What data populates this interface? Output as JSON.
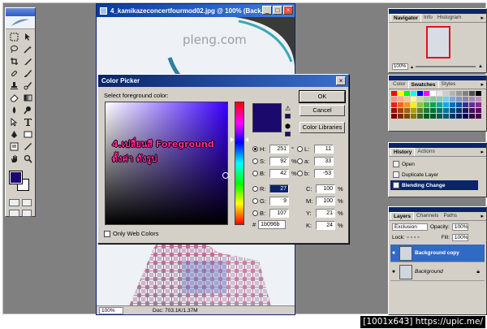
{
  "document": {
    "title": "4_kamikazeconcertfourmod02.jpg @ 100% (Back...",
    "watermark": "pleng.com",
    "zoom": "100%",
    "doc_size": "Doc: 703.1K/1.37M"
  },
  "color_picker": {
    "title": "Color Picker",
    "label": "Select foreground color:",
    "buttons": {
      "ok": "OK",
      "cancel": "Cancel",
      "libraries": "Color Libraries"
    },
    "hsb": [
      {
        "key": "H:",
        "value": "251",
        "unit": "°",
        "selected": true
      },
      {
        "key": "S:",
        "value": "92",
        "unit": "%",
        "selected": false
      },
      {
        "key": "B:",
        "value": "42",
        "unit": "%",
        "selected": false
      }
    ],
    "rgb": [
      {
        "key": "R:",
        "value": "27",
        "unit": "",
        "highlight": true
      },
      {
        "key": "G:",
        "value": "9",
        "unit": "",
        "highlight": false
      },
      {
        "key": "B:",
        "value": "107",
        "unit": "",
        "highlight": false
      }
    ],
    "lab": [
      {
        "key": "L:",
        "value": "11"
      },
      {
        "key": "a:",
        "value": "33"
      },
      {
        "key": "b:",
        "value": "-53"
      }
    ],
    "cmyk": [
      {
        "key": "C:",
        "value": "100",
        "unit": "%"
      },
      {
        "key": "M:",
        "value": "100",
        "unit": "%"
      },
      {
        "key": "Y:",
        "value": "21",
        "unit": "%"
      },
      {
        "key": "K:",
        "value": "24",
        "unit": "%"
      }
    ],
    "hex_label": "#",
    "hex": "1b096b",
    "only_web": "Only Web Colors",
    "current_color": "#1b096b"
  },
  "overlay_text": "4.เปลี่ยนสี Foreground\nตั้งค่า ดังรูป",
  "navigator": {
    "tabs": [
      "Navigator",
      "Info",
      "Histogram"
    ],
    "zoom": "100%"
  },
  "swatches": {
    "tabs": [
      "Color",
      "Swatches",
      "Styles"
    ]
  },
  "history": {
    "tabs": [
      "History",
      "Actions"
    ],
    "items": [
      "Open",
      "Duplicate Layer",
      "Blending Change"
    ]
  },
  "layers": {
    "tabs": [
      "Layers",
      "Channels",
      "Paths"
    ],
    "blend_mode": "Exclusion",
    "opacity_label": "Opacity:",
    "opacity": "100%",
    "lock_label": "Lock:",
    "fill_label": "Fill:",
    "fill": "100%",
    "items": [
      {
        "name": "Background copy",
        "selected": true
      },
      {
        "name": "Background",
        "selected": false
      }
    ]
  },
  "caption": "[1001x643] https://upic.me/"
}
